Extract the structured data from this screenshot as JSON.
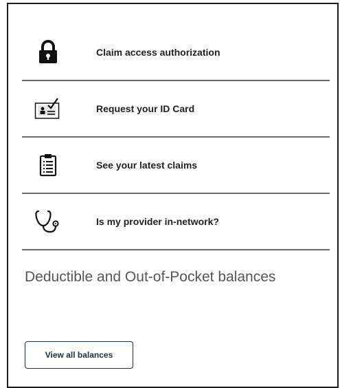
{
  "menu": {
    "items": [
      {
        "label": "Claim access authorization",
        "icon": "lock-icon"
      },
      {
        "label": "Request your ID Card",
        "icon": "id-card-check-icon"
      },
      {
        "label": "See your latest claims",
        "icon": "clipboard-icon"
      },
      {
        "label": "Is my provider in-network?",
        "icon": "stethoscope-icon"
      }
    ]
  },
  "balances": {
    "title": "Deductible and Out-of-Pocket balances",
    "button_label": "View all balances"
  },
  "colors": {
    "text": "#1f1f1f",
    "divider": "#6b6b6b",
    "section_title": "#555555",
    "button_border": "#1f2a44"
  }
}
